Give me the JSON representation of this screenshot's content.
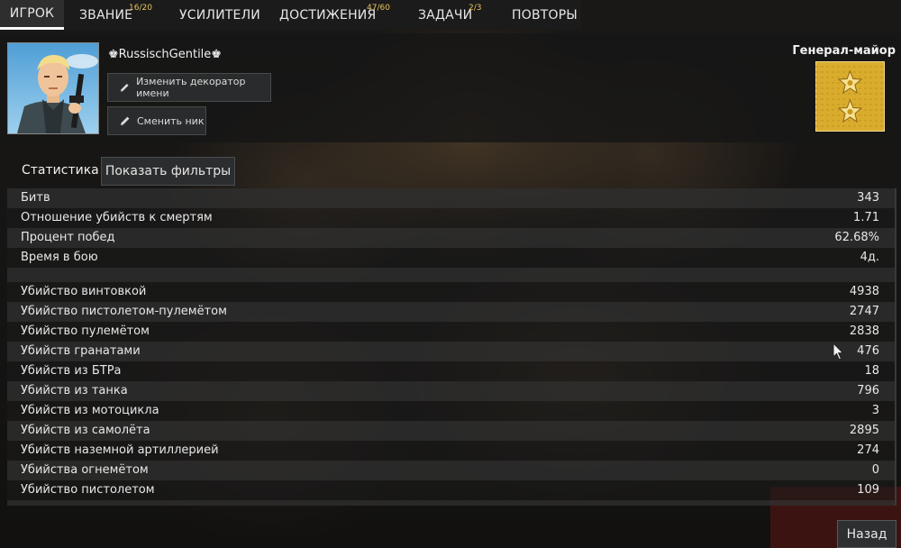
{
  "nav": {
    "tabs": [
      {
        "label": "ИГРОК",
        "badge": ""
      },
      {
        "label": "ЗВАНИЕ",
        "badge": "16/20"
      },
      {
        "label": "УСИЛИТЕЛИ",
        "badge": ""
      },
      {
        "label": "ДОСТИЖЕНИЯ",
        "badge": "47/60"
      },
      {
        "label": "ЗАДАЧИ",
        "badge": "2/3"
      },
      {
        "label": "ПОВТОРЫ",
        "badge": ""
      }
    ],
    "active_tab": "ИГРОК"
  },
  "profile": {
    "username": "♚RussischGentile♚",
    "change_decorator_label": "Изменить декоратор имени",
    "change_nick_label": "Сменить ник",
    "rank_title": "Генерал-майор"
  },
  "stats": {
    "tab_label": "Статистика",
    "filter_button_label": "Показать фильтры",
    "summary": [
      {
        "label": "Битв",
        "value": "343"
      },
      {
        "label": "Отношение убийств к смертям",
        "value": "1.71"
      },
      {
        "label": "Процент побед",
        "value": "62.68%"
      },
      {
        "label": "Время в бою",
        "value": "4д."
      }
    ],
    "kills": [
      {
        "label": "Убийство винтовкой",
        "value": "4938"
      },
      {
        "label": "Убийство пистолетом-пулемётом",
        "value": "2747"
      },
      {
        "label": "Убийство пулемётом",
        "value": "2838"
      },
      {
        "label": "Убийств гранатами",
        "value": "476"
      },
      {
        "label": "Убийств из БТРа",
        "value": "18"
      },
      {
        "label": "Убийств из танка",
        "value": "796"
      },
      {
        "label": "Убийств из мотоцикла",
        "value": "3"
      },
      {
        "label": "Убийств из самолёта",
        "value": "2895"
      },
      {
        "label": "Убийств наземной артиллерией",
        "value": "274"
      },
      {
        "label": "Убийства огнемётом",
        "value": "0"
      },
      {
        "label": "Убийство пистолетом",
        "value": "109"
      }
    ]
  },
  "footer": {
    "back_label": "Назад"
  },
  "colors": {
    "accent_badge": "#e8c35a",
    "insignia_gold": "#d9ac2e"
  }
}
